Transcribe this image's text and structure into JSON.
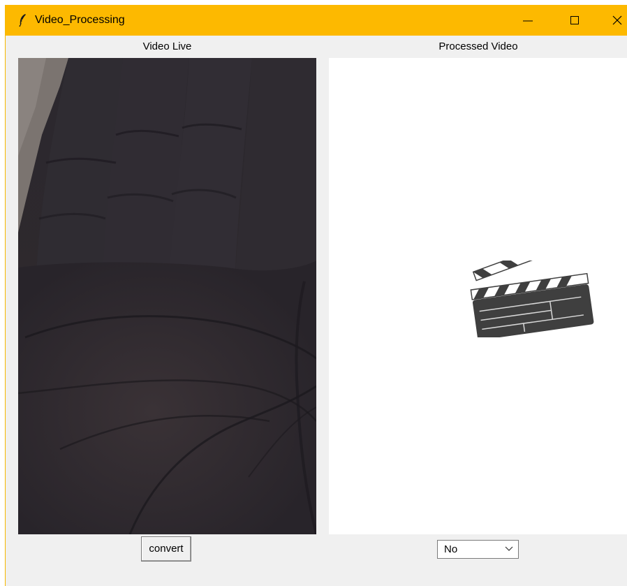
{
  "window": {
    "title": "Video_Processing",
    "title_bar_color": "#fdb900",
    "app_icon": "feather-icon",
    "controls": [
      "minimize-icon",
      "maximize-icon",
      "close-icon"
    ]
  },
  "left_panel": {
    "label": "Video Live",
    "content": "live-camera-feed"
  },
  "right_panel": {
    "label": "Processed Video",
    "placeholder_icon": "clapperboard-icon"
  },
  "controls": {
    "convert_label": "convert",
    "select_value": "No"
  }
}
